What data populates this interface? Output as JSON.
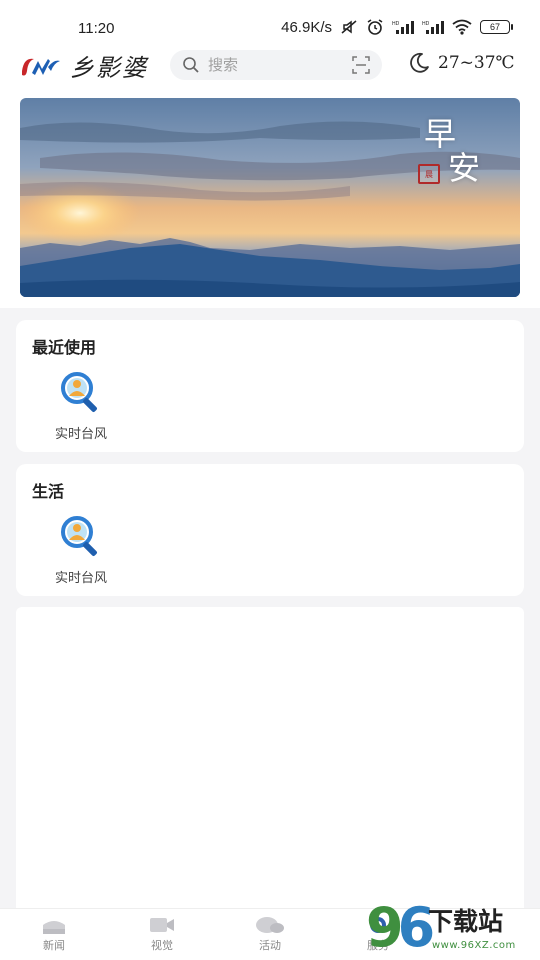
{
  "status_bar": {
    "time": "11:20",
    "net_speed": "46.9K/s",
    "battery": "67"
  },
  "header": {
    "logo_text": "乡影婆",
    "search": {
      "placeholder": "搜索"
    },
    "weather": "27~37℃"
  },
  "banner": {
    "line1": "早",
    "line2": "安",
    "seal": "晨"
  },
  "sections": [
    {
      "title": "最近使用",
      "apps": [
        {
          "label": "实时台风",
          "icon": "search-person-icon"
        }
      ]
    },
    {
      "title": "生活",
      "apps": [
        {
          "label": "实时台风",
          "icon": "search-person-icon"
        }
      ]
    }
  ],
  "bottom_nav": [
    {
      "label": "新闻",
      "icon": "news-icon"
    },
    {
      "label": "视觉",
      "icon": "video-icon"
    },
    {
      "label": "活动",
      "icon": "activity-icon"
    },
    {
      "label": "服务",
      "icon": "service-icon"
    }
  ],
  "watermark": {
    "digits_left": "9",
    "digits_right": "6",
    "title": "下载站",
    "url": "www.96XZ.com"
  },
  "colors": {
    "background": "#f4f4f6",
    "card": "#ffffff",
    "icon_blue": "#2f7fd3",
    "icon_gold": "#f2a83a"
  }
}
